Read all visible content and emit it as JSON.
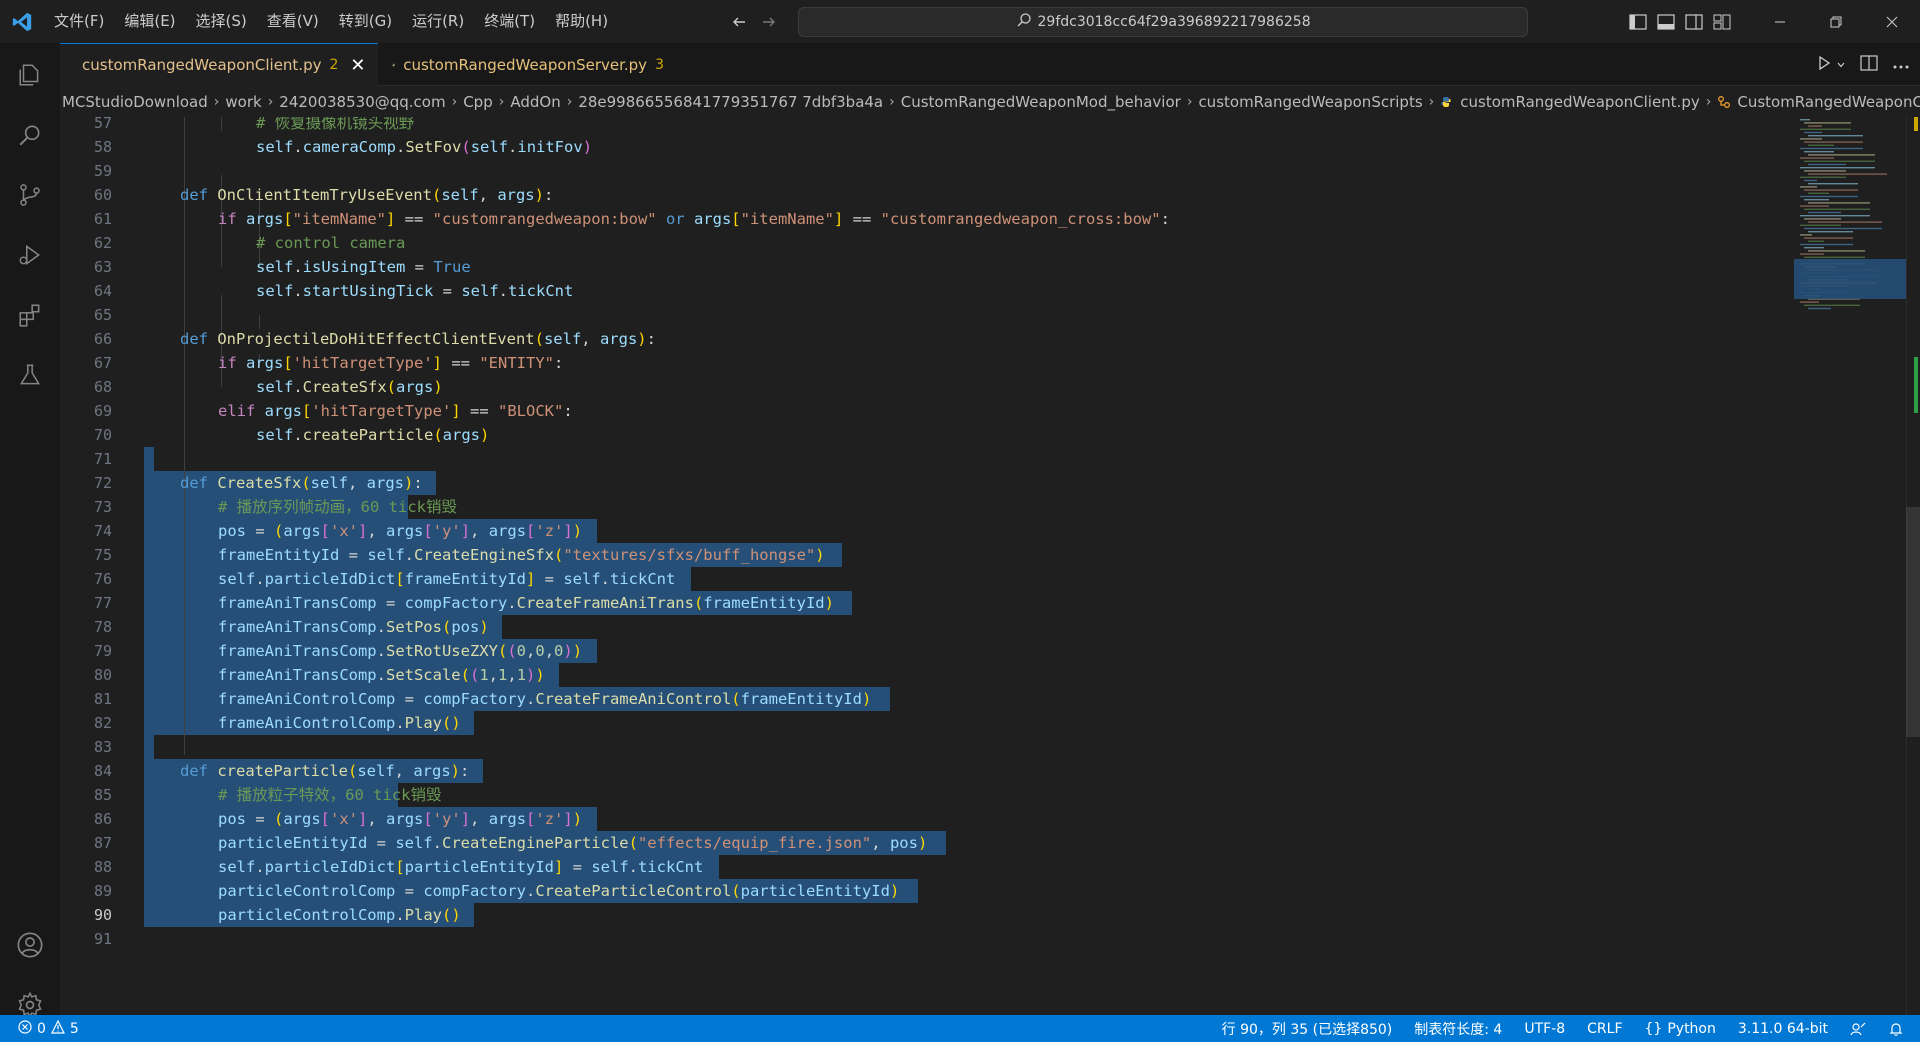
{
  "titlebar": {
    "menu": [
      "文件(F)",
      "编辑(E)",
      "选择(S)",
      "查看(V)",
      "转到(G)",
      "运行(R)",
      "终端(T)",
      "帮助(H)"
    ],
    "command_center": "29fdc3018cc64f29a396892217986258"
  },
  "tabs": [
    {
      "name": "customRangedWeaponClient.py",
      "count": "2",
      "close": "✕"
    },
    {
      "name": "customRangedWeaponServer.py",
      "count": "3"
    }
  ],
  "breadcrumb": [
    "MCStudioDownload",
    "work",
    "2420038530@qq.com",
    "Cpp",
    "AddOn",
    "28e9986655684177935176 77dbf3ba4a",
    "CustomRangedWeaponMod_behavior",
    "customRangedWeaponScripts",
    "customRangedWeaponClient.py",
    "CustomRangedWeaponClient"
  ],
  "breadcrumb_fix": "28e99866556841779351767 7dbf3ba4a",
  "code": {
    "line_numbers": [
      "57",
      "58",
      "59",
      "60",
      "61",
      "62",
      "63",
      "64",
      "65",
      "66",
      "67",
      "68",
      "69",
      "70",
      "71",
      "72",
      "73",
      "74",
      "75",
      "76",
      "77",
      "78",
      "79",
      "80",
      "81",
      "82",
      "83",
      "84",
      "85",
      "86",
      "87",
      "88",
      "89",
      "90",
      "91"
    ],
    "current_line": "90"
  },
  "statusbar": {
    "errors": "0",
    "warnings": "5",
    "cursor": "行 90，列 35 (已选择850)",
    "tab_size": "制表符长度: 4",
    "encoding": "UTF-8",
    "eol": "CRLF",
    "language": "Python",
    "interpreter": "3.11.0 64-bit"
  },
  "colors": {
    "accent": "#0078d4",
    "selection": "#264f78",
    "editor_bg": "#1f1f1f"
  }
}
